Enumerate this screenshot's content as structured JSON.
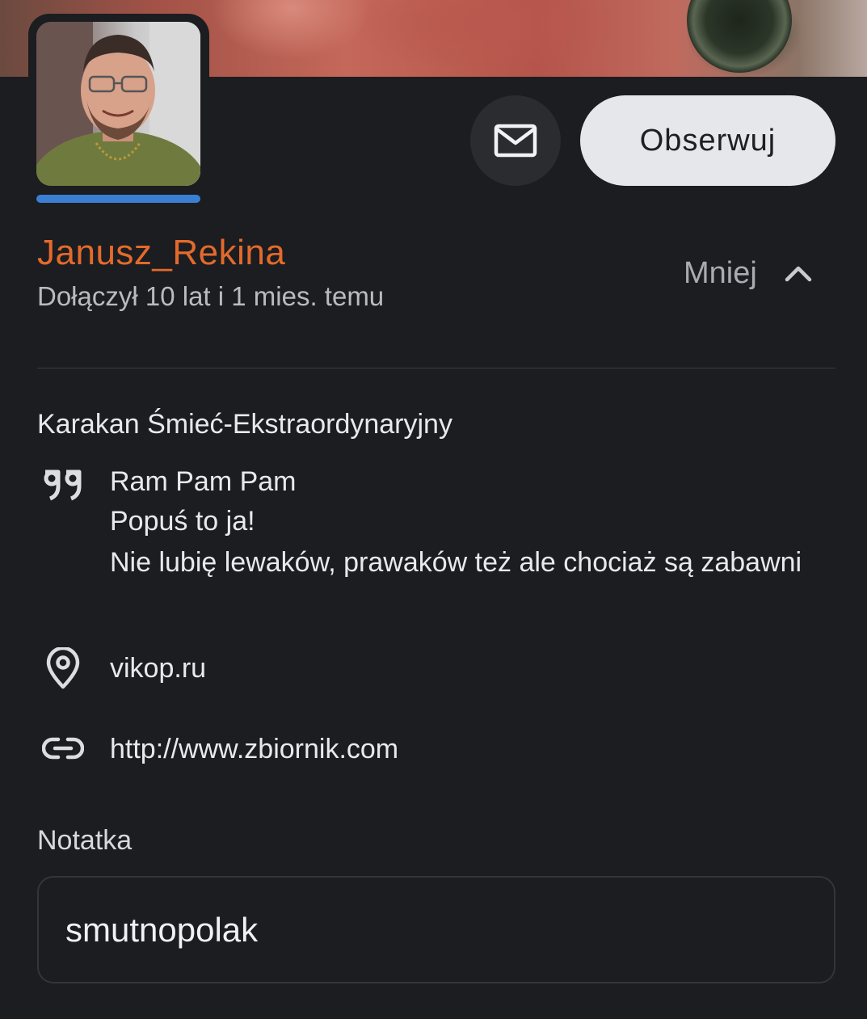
{
  "profile": {
    "username": "Janusz_Rekina",
    "joined": "Dołączył 10 lat i 1 mies. temu",
    "toggle_label": "Mniej",
    "rank": "Karakan Śmieć-Ekstraordynaryjny",
    "bio_lines": [
      "Ram Pam Pam",
      "Popuś to ja!",
      "Nie lubię lewaków, prawaków też ale chociaż są zabawni"
    ],
    "location": "vikop.ru",
    "website": "http://www.zbiornik.com"
  },
  "actions": {
    "follow_label": "Obserwuj"
  },
  "note": {
    "label": "Notatka",
    "value": "smutnopolak"
  },
  "colors": {
    "background": "#1b1d20",
    "username": "#e36a2c",
    "avatar_bar": "#3b7fd2",
    "follow_button_bg": "#e6e7ea"
  },
  "icons": {
    "message": "mail-icon",
    "toggle": "chevron-up-icon",
    "bio": "quote-icon",
    "location": "location-pin-icon",
    "website": "link-icon"
  }
}
